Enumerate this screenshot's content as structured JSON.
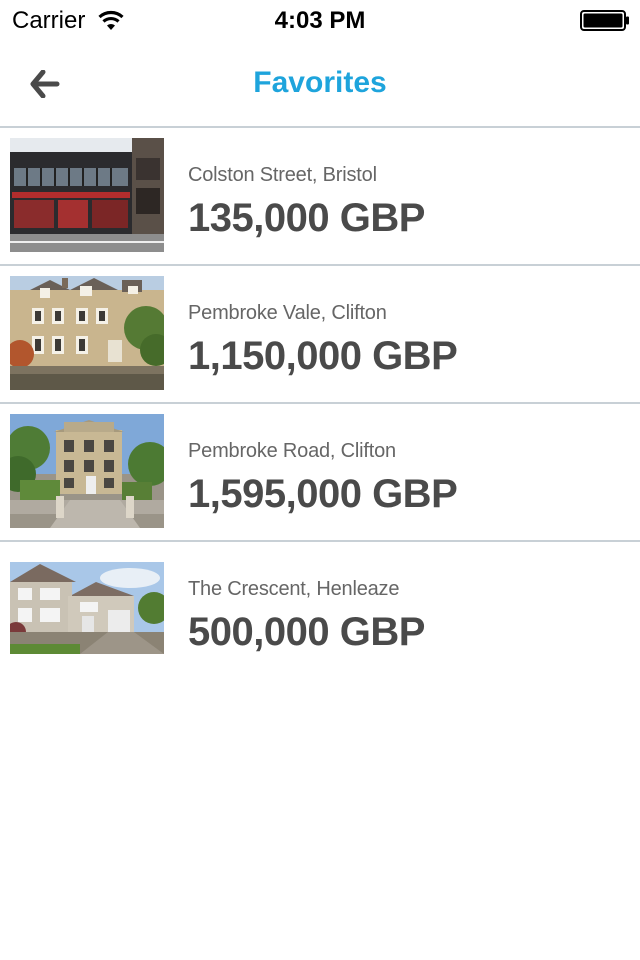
{
  "status_bar": {
    "carrier": "Carrier",
    "time": "4:03 PM"
  },
  "nav": {
    "title": "Favorites",
    "back_icon": "back-arrow-icon"
  },
  "theme": {
    "accent": "#1ea4dc",
    "text": "#4a4a4a",
    "divider": "#c8d0d6"
  },
  "favorites": [
    {
      "address": "Colston Street, Bristol",
      "price": "135,000 GBP"
    },
    {
      "address": "Pembroke Vale, Clifton",
      "price": "1,150,000 GBP"
    },
    {
      "address": "Pembroke Road, Clifton",
      "price": "1,595,000 GBP"
    },
    {
      "address": "The Crescent, Henleaze",
      "price": "500,000 GBP"
    }
  ]
}
